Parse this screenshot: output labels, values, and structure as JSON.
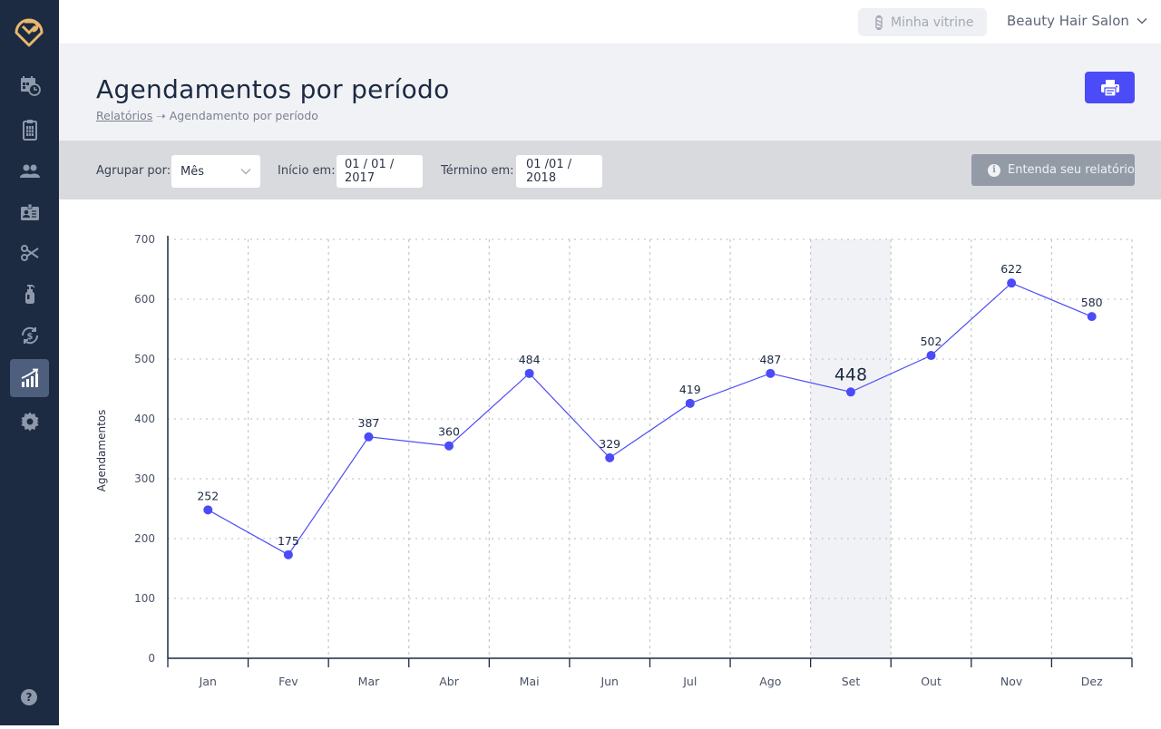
{
  "sidebar": {
    "items": [
      {
        "icon": "calendar-clock-icon",
        "active": false
      },
      {
        "icon": "calculator-icon",
        "active": false
      },
      {
        "icon": "users-icon",
        "active": false
      },
      {
        "icon": "id-card-icon",
        "active": false
      },
      {
        "icon": "scissors-icon",
        "active": false
      },
      {
        "icon": "product-bottle-icon",
        "active": false
      },
      {
        "icon": "money-cycle-icon",
        "active": false
      },
      {
        "icon": "chart-growth-icon",
        "active": true
      },
      {
        "icon": "gear-icon",
        "active": false
      }
    ],
    "help": "?"
  },
  "topbar": {
    "vitrine_label": "Minha vitrine",
    "account_name": "Beauty Hair Salon"
  },
  "header": {
    "title": "Agendamentos por período",
    "breadcrumb_link": "Relatórios",
    "breadcrumb_sep": "➝",
    "breadcrumb_current": "Agendamento por período"
  },
  "filters": {
    "group_label": "Agrupar por:",
    "group_value": "Mês",
    "start_label": "Início em:",
    "start_value": "01 / 01 / 2017",
    "end_label": "Término em:",
    "end_value": "01 /01 / 2018",
    "info_button": "Entenda seu relatório"
  },
  "colors": {
    "accent": "#4b4bf8",
    "sidebar": "#1c2a42",
    "logo": "#e8b86d",
    "highlight_band": "#f1f2f5"
  },
  "chart_data": {
    "type": "line",
    "title": "",
    "xlabel": "",
    "ylabel": "Agendamentos",
    "ylim": [
      0,
      700
    ],
    "yticks": [
      0,
      100,
      200,
      300,
      400,
      500,
      600,
      700
    ],
    "grid": true,
    "categories": [
      "Jan",
      "Fev",
      "Mar",
      "Abr",
      "Mai",
      "Jun",
      "Jul",
      "Ago",
      "Set",
      "Out",
      "Nov",
      "Dez"
    ],
    "series": [
      {
        "name": "Agendamentos",
        "labels": [
          252,
          175,
          387,
          360,
          484,
          329,
          419,
          487,
          448,
          502,
          622,
          580
        ],
        "values": [
          248,
          173,
          370,
          355,
          476,
          335,
          426,
          476,
          445,
          506,
          627,
          571
        ]
      }
    ],
    "highlighted_category": "Set"
  }
}
